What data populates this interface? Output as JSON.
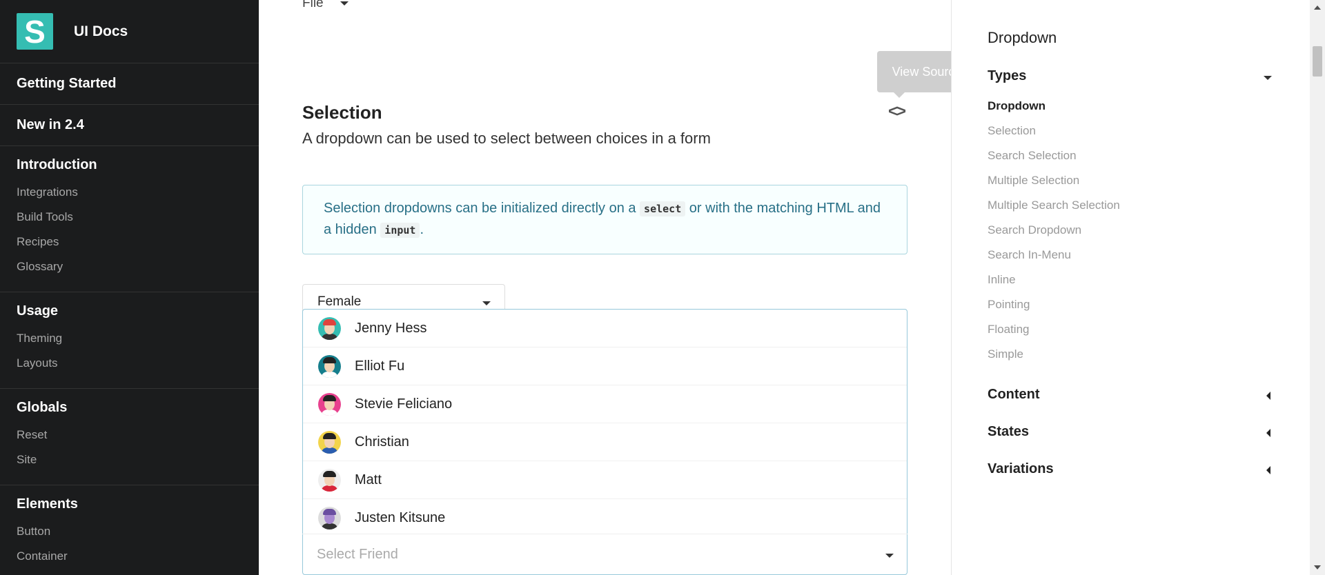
{
  "sidebar": {
    "logo_letter": "S",
    "logo_text": "UI Docs",
    "sections": [
      {
        "title": "Getting Started",
        "items": []
      },
      {
        "title": "New in 2.4",
        "items": []
      },
      {
        "title": "Introduction",
        "items": [
          "Integrations",
          "Build Tools",
          "Recipes",
          "Glossary"
        ]
      },
      {
        "title": "Usage",
        "items": [
          "Theming",
          "Layouts"
        ]
      },
      {
        "title": "Globals",
        "items": [
          "Reset",
          "Site"
        ]
      },
      {
        "title": "Elements",
        "items": [
          "Button",
          "Container"
        ]
      }
    ]
  },
  "main": {
    "file_label": "File",
    "tooltip": "View Source",
    "code_icon": "<>",
    "section_title": "Selection",
    "section_desc": "A dropdown can be used to select between choices in a form",
    "info": {
      "text1": "Selection dropdowns can be initialized directly on a ",
      "code1": "select",
      "text2": " or with the matching HTML and a hidden ",
      "code2": "input",
      "text3": "."
    },
    "gender_dropdown_value": "Female",
    "friend_menu": [
      {
        "name": "Jenny Hess",
        "icon": "avatar-icon"
      },
      {
        "name": "Elliot Fu",
        "icon": "avatar-icon"
      },
      {
        "name": "Stevie Feliciano",
        "icon": "avatar-icon"
      },
      {
        "name": "Christian",
        "icon": "avatar-icon"
      },
      {
        "name": "Matt",
        "icon": "avatar-icon"
      },
      {
        "name": "Justen Kitsune",
        "icon": "avatar-icon"
      }
    ],
    "friend_placeholder": "Select Friend"
  },
  "rightrail": {
    "title": "Dropdown",
    "groups": [
      {
        "label": "Types",
        "expanded": true,
        "items": [
          "Dropdown",
          "Selection",
          "Search Selection",
          "Multiple Selection",
          "Multiple Search Selection",
          "Search Dropdown",
          "Search In-Menu",
          "Inline",
          "Pointing",
          "Floating",
          "Simple"
        ]
      },
      {
        "label": "Content",
        "expanded": false
      },
      {
        "label": "States",
        "expanded": false
      },
      {
        "label": "Variations",
        "expanded": false
      }
    ]
  },
  "colors": {
    "brand": "#35bdb2",
    "sidebar_bg": "#1b1c1d",
    "info_text": "#276f86",
    "menu_border": "#96c8da"
  }
}
